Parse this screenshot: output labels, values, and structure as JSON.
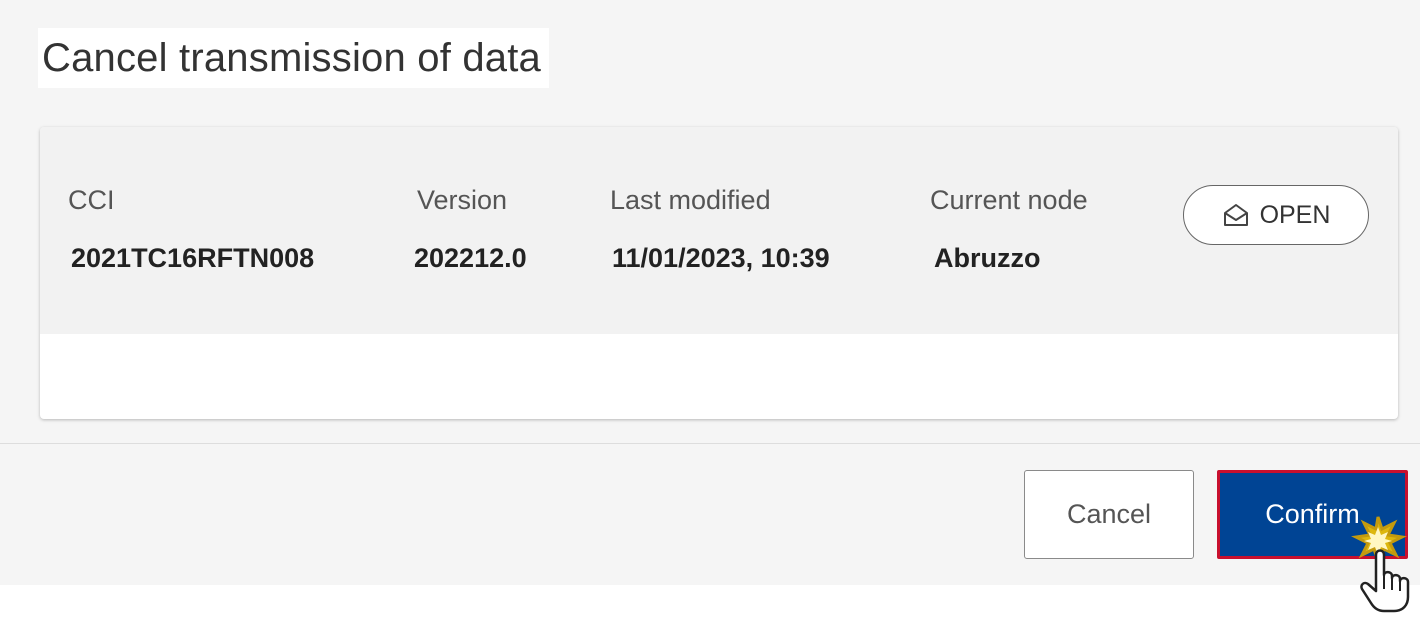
{
  "dialog": {
    "title": "Cancel transmission of data"
  },
  "record": {
    "cci": {
      "label": "CCI",
      "value": "2021TC16RFTN008"
    },
    "version": {
      "label": "Version",
      "value": "202212.0"
    },
    "last_modified": {
      "label": "Last modified",
      "value": "11/01/2023, 10:39"
    },
    "current_node": {
      "label": "Current node",
      "value": "Abruzzo"
    },
    "status": {
      "label": "OPEN",
      "icon": "envelope-open-icon"
    }
  },
  "actions": {
    "cancel_label": "Cancel",
    "confirm_label": "Confirm"
  },
  "annotation": {
    "icon": "hand-pointer-click-icon"
  },
  "colors": {
    "confirm_bg": "#004494",
    "highlight_border": "#c8102e",
    "header_bg": "#f2f2f2",
    "dialog_bg": "#f5f5f5"
  }
}
